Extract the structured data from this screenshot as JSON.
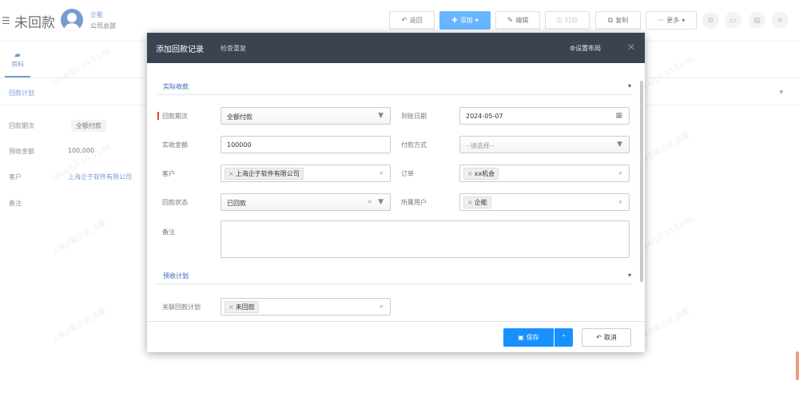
{
  "header": {
    "title": "未回款",
    "owner_name": "企能",
    "owner_dept": "公司总部"
  },
  "toolbar": {
    "back": "返回",
    "add": "添加",
    "edit": "编辑",
    "print": "打印",
    "copy": "复制",
    "more": "更多"
  },
  "tabs": {
    "info": "资料"
  },
  "plan_section": {
    "title": "回款计划"
  },
  "detail": {
    "period_label": "回款期次",
    "period_value": "全额付款",
    "amount_label": "预收金额",
    "amount_value": "100,000",
    "customer_label": "客户",
    "customer_value": "上海企于软件有限公司",
    "remark_label": "备注"
  },
  "watermark": {
    "date": "2024/5/7 13:53:00",
    "text": "上海企能企业_企能"
  },
  "modal": {
    "title": "添加回款记录",
    "subtitle": "检查重复",
    "layout": "设置布局",
    "section_actual": "实际收款",
    "section_plan": "预收计划",
    "fields": {
      "period": {
        "label": "回款期次",
        "value": "全额付款"
      },
      "due_date": {
        "label": "到账日期",
        "value": "2024-05-07"
      },
      "amount": {
        "label": "实收金额",
        "value": "100000"
      },
      "pay_method": {
        "label": "付款方式",
        "placeholder": "--请选择--"
      },
      "customer": {
        "label": "客户",
        "tag": "上海企于软件有限公司"
      },
      "order": {
        "label": "订单",
        "tag": "xx机会"
      },
      "status": {
        "label": "回款状态",
        "value": "已回款"
      },
      "owner": {
        "label": "所属用户",
        "tag": "企能"
      },
      "remark": {
        "label": "备注"
      },
      "related_plan": {
        "label": "关联回款计划",
        "tag": "未回款"
      }
    },
    "save": "保存",
    "cancel": "取消"
  }
}
